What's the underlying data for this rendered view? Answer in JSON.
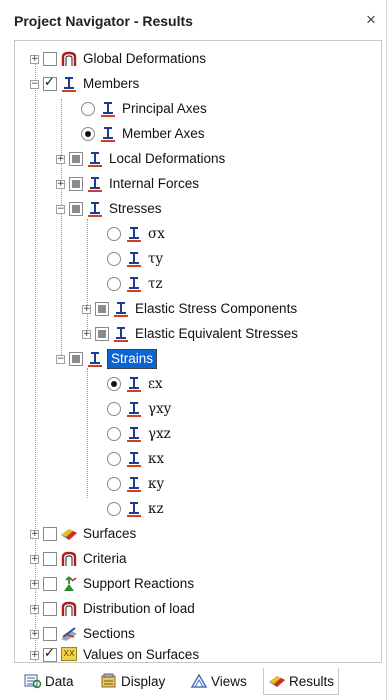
{
  "window": {
    "title": "Project Navigator - Results",
    "close_glyph": "×"
  },
  "tree": {
    "global_deformations": "Global Deformations",
    "members": "Members",
    "principal_axes": "Principal Axes",
    "member_axes": "Member Axes",
    "local_deformations": "Local Deformations",
    "internal_forces": "Internal Forces",
    "stresses": "Stresses",
    "sigma_x": "σx",
    "tau_y": "τy",
    "tau_z": "τz",
    "elastic_stress_components": "Elastic Stress Components",
    "elastic_equivalent_stresses": "Elastic Equivalent Stresses",
    "strains": "Strains",
    "eps_x": "εx",
    "gamma_xy": "γxy",
    "gamma_xz": "γxz",
    "kappa_x": "κx",
    "kappa_y": "κy",
    "kappa_z": "κz",
    "surfaces": "Surfaces",
    "criteria": "Criteria",
    "support_reactions": "Support Reactions",
    "distribution_of_load": "Distribution of load",
    "sections": "Sections",
    "values_on_surfaces": "Values on Surfaces",
    "values_icon_text": "XX"
  },
  "tabs": {
    "data": "Data",
    "display": "Display",
    "views": "Views",
    "results": "Results"
  },
  "colors": {
    "accent": "#0a64d2",
    "member_icon": "#1f3b8f",
    "deform_icon": "#b01d1d"
  }
}
